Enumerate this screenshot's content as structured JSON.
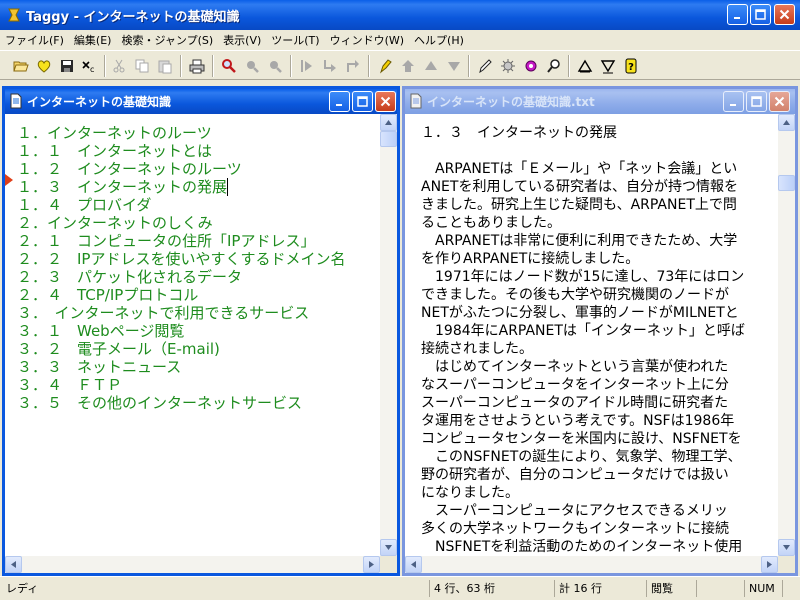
{
  "app": {
    "title": "Taggy - インターネットの基礎知識",
    "icon": "taggy-app-icon"
  },
  "menu": {
    "items": [
      {
        "label": "ファイル(F)"
      },
      {
        "label": "編集(E)"
      },
      {
        "label": "検索・ジャンプ(S)"
      },
      {
        "label": "表示(V)"
      },
      {
        "label": "ツール(T)"
      },
      {
        "label": "ウィンドウ(W)"
      },
      {
        "label": "ヘルプ(H)"
      }
    ]
  },
  "toolbar": {
    "buttons": [
      {
        "name": "open-folder-icon"
      },
      {
        "name": "favorite-heart-icon"
      },
      {
        "name": "save-disk-icon"
      },
      {
        "name": "close-file-icon"
      },
      {
        "name": "cut-icon",
        "disabled": true
      },
      {
        "name": "copy-icon",
        "disabled": true
      },
      {
        "name": "paste-icon",
        "disabled": true
      },
      {
        "name": "print-icon"
      },
      {
        "name": "search-icon"
      },
      {
        "name": "search-prev-icon",
        "disabled": true
      },
      {
        "name": "search-next-icon",
        "disabled": true
      },
      {
        "name": "jump-right-icon",
        "disabled": true
      },
      {
        "name": "jump-down-right-icon",
        "disabled": true
      },
      {
        "name": "jump-up-icon",
        "disabled": true
      },
      {
        "name": "tag-pen-icon"
      },
      {
        "name": "level-up-icon",
        "disabled": true
      },
      {
        "name": "move-up-icon",
        "disabled": true
      },
      {
        "name": "move-down-icon",
        "disabled": true
      },
      {
        "name": "edit-pencil-icon"
      },
      {
        "name": "tool-gear-icon"
      },
      {
        "name": "tool-color-icon"
      },
      {
        "name": "find-replace-icon"
      },
      {
        "name": "outline-collapse-icon"
      },
      {
        "name": "outline-expand-icon"
      },
      {
        "name": "help-icon"
      }
    ]
  },
  "outline_window": {
    "title": "インターネットの基礎知識",
    "current_index": 3,
    "items": [
      {
        "label": "１．インターネットのルーツ"
      },
      {
        "label": "１．１　インターネットとは"
      },
      {
        "label": "１．２　インターネットのルーツ"
      },
      {
        "label": "１．３　インターネットの発展"
      },
      {
        "label": "１．４　プロバイダ"
      },
      {
        "label": "２．インターネットのしくみ"
      },
      {
        "label": "２．１　コンピュータの住所「IPアドレス」"
      },
      {
        "label": "２．２　IPアドレスを使いやすくするドメイン名"
      },
      {
        "label": "２．３　パケット化されるデータ"
      },
      {
        "label": "２．４　TCP/IPプロトコル"
      },
      {
        "label": "３．　インターネットで利用できるサービス"
      },
      {
        "label": "３．１　Webページ閲覧"
      },
      {
        "label": "３．２　電子メール（E-mail)"
      },
      {
        "label": "３．３　ネットニュース"
      },
      {
        "label": "３．４　ＦＴＰ"
      },
      {
        "label": "３．５　その他のインターネットサービス"
      }
    ]
  },
  "text_window": {
    "title": "インターネットの基礎知識.txt",
    "lines": [
      "１．３　インターネットの発展",
      "",
      "　ARPANETは「Ｅメール」や「ネット会議」とい",
      "ANETを利用している研究者は、自分が持つ情報を",
      "きました。研究上生じた疑問も、ARPANET上で問",
      "ることもありました。",
      "　ARPANETは非常に便利に利用できたため、大学",
      "を作りARPANETに接続しました。",
      "　1971年にはノード数が15に達し、73年にはロン",
      "できました。その後も大学や研究機関のノードが",
      "NETがふたつに分裂し、軍事的ノードがMILNETと",
      "　1984年にARPANETは「インターネット」と呼ば",
      "接続されました。",
      "　はじめてインターネットという言葉が使われた",
      "なスーパーコンピュータをインターネット上に分",
      "スーパーコンピュータのアイドル時間に研究者た",
      "タ運用をさせようという考えです。NSFは1986年",
      "コンピュータセンターを米国内に設け、NSFNETを",
      "　このNSFNETの誕生により、気象学、物理工学、",
      "野の研究者が、自分のコンピュータだけでは扱い",
      "になりました。",
      "　スーパーコンピュータにアクセスできるメリッ",
      "多くの大学ネットワークもインターネットに接続",
      "　NSFNETを利益活動のためのインターネット使用"
    ]
  },
  "statusbar": {
    "mode": "レディ",
    "position": "4 行、63 桁",
    "total": "計 16 行",
    "access": "閲覧",
    "numlock": "NUM"
  },
  "colors": {
    "outline_text": "#1E8C1E",
    "current_marker": "#E0401A",
    "active_title": "#0A58DF",
    "inactive_title": "#7A96DF"
  }
}
